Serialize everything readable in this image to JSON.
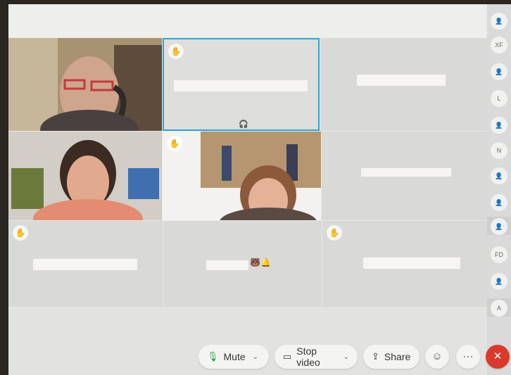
{
  "toolbar": {
    "mute_label": "Mute",
    "stop_video_label": "Stop video",
    "share_label": "Share",
    "reactions_icon": "smile-icon",
    "more_label": "···",
    "leave_label": "✕"
  },
  "participants_panel": {
    "avatars": [
      {
        "label": "",
        "icon": "person-icon"
      },
      {
        "label": "XF"
      },
      {
        "label": "",
        "icon": "person-icon"
      },
      {
        "label": "L"
      },
      {
        "label": "",
        "icon": "person-icon"
      },
      {
        "label": "N"
      },
      {
        "label": "",
        "icon": "person-icon"
      },
      {
        "label": "",
        "icon": "person-icon"
      },
      {
        "label": "",
        "icon": "person-icon"
      },
      {
        "label": "FD"
      },
      {
        "label": "",
        "icon": "person-icon"
      },
      {
        "label": "A"
      }
    ]
  },
  "tiles": [
    {
      "type": "video",
      "hand": false
    },
    {
      "type": "avatar",
      "hand": true,
      "active": true,
      "sub_icon": "headset-icon"
    },
    {
      "type": "avatar",
      "hand": false
    },
    {
      "type": "video",
      "hand": false
    },
    {
      "type": "video",
      "hand": true
    },
    {
      "type": "avatar",
      "hand": false
    },
    {
      "type": "avatar",
      "hand": true
    },
    {
      "type": "avatar",
      "hand": false,
      "name_suffix": "🐻🔔"
    },
    {
      "type": "avatar",
      "hand": true
    }
  ],
  "colors": {
    "active_border": "#2aa6d6",
    "leave": "#d93a2b"
  }
}
